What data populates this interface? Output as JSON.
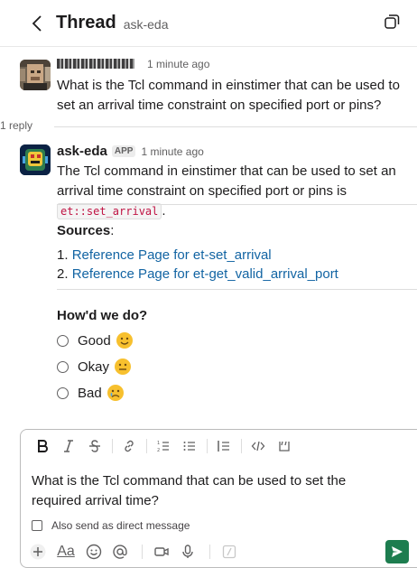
{
  "header": {
    "title": "Thread",
    "channel": "ask-eda"
  },
  "messages": {
    "question": {
      "time": "1 minute ago",
      "text": "What is the Tcl command in einstimer that can be used to set an arrival time constraint on specified port or pins?"
    },
    "reply_count": "1 reply",
    "answer": {
      "author": "ask-eda",
      "badge": "APP",
      "time": "1 minute ago",
      "text_before": "The Tcl command in einstimer that can be used to set an arrival time constraint on specified port or pins is ",
      "code": "et::set_arrival",
      "text_after": ".",
      "sources_title": "Sources",
      "sources_colon": ":",
      "sources": [
        {
          "num": "1.",
          "label": "Reference Page for et-set_arrival"
        },
        {
          "num": "2.",
          "label": "Reference Page for et-get_valid_arrival_port"
        }
      ],
      "feedback_title": "How'd we do?",
      "feedback_options": [
        "Good",
        "Okay",
        "Bad"
      ]
    }
  },
  "composer": {
    "text": "What is the Tcl command that can be used to set the required arrival time?",
    "dm_label": "Also send as direct message",
    "format_label": "Aa"
  },
  "colors": {
    "link": "#1264a3",
    "send": "#1d7d4f",
    "code": "#c01343"
  }
}
